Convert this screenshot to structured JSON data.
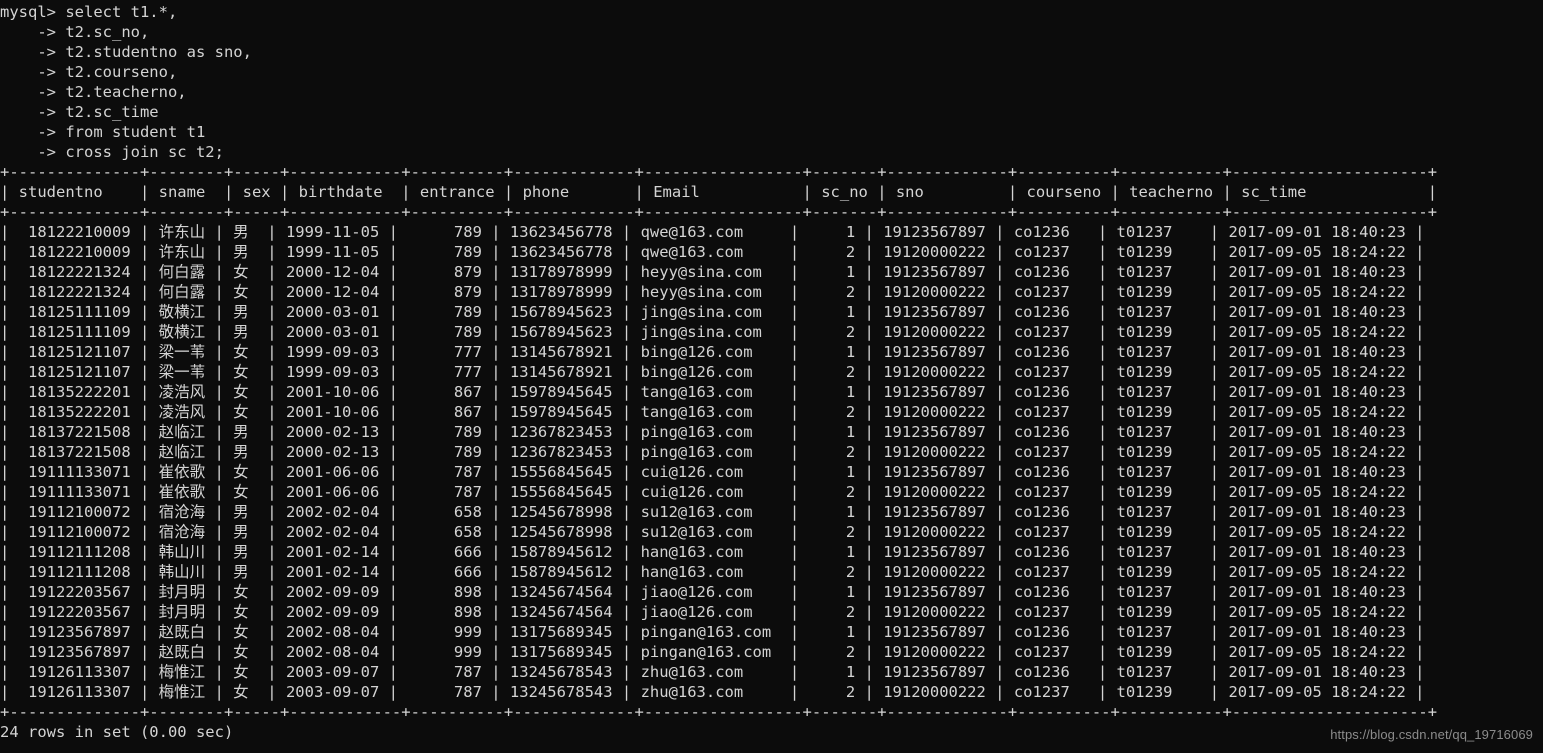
{
  "terminal": {
    "prompt": "mysql>",
    "continuation": "    ->",
    "query_lines": [
      "select t1.*,",
      "t2.sc_no,",
      "t2.studentno as sno,",
      "t2.courseno,",
      "t2.teacherno,",
      "t2.sc_time",
      "from student t1",
      "cross join sc t2;"
    ],
    "result_status": "24 rows in set (0.00 sec)",
    "watermark": "https://blog.csdn.net/qq_19716069",
    "colors": {
      "background": "#0c0c0c",
      "foreground": "#d4d4d4",
      "border": "#c8c2b8",
      "watermark": "#8c8c8c"
    }
  },
  "table": {
    "columns": [
      {
        "key": "studentno",
        "label": "studentno",
        "width": 12,
        "align": "right"
      },
      {
        "key": "sname",
        "label": "sname",
        "width": 6,
        "align": "left"
      },
      {
        "key": "sex",
        "label": "sex",
        "width": 3,
        "align": "left"
      },
      {
        "key": "birthdate",
        "label": "birthdate",
        "width": 10,
        "align": "left"
      },
      {
        "key": "entrance",
        "label": "entrance",
        "width": 8,
        "align": "right"
      },
      {
        "key": "phone",
        "label": "phone",
        "width": 11,
        "align": "left"
      },
      {
        "key": "Email",
        "label": "Email",
        "width": 15,
        "align": "left"
      },
      {
        "key": "sc_no",
        "label": "sc_no",
        "width": 5,
        "align": "right"
      },
      {
        "key": "sno",
        "label": "sno",
        "width": 11,
        "align": "left"
      },
      {
        "key": "courseno",
        "label": "courseno",
        "width": 8,
        "align": "left"
      },
      {
        "key": "teacherno",
        "label": "teacherno",
        "width": 9,
        "align": "left"
      },
      {
        "key": "sc_time",
        "label": "sc_time",
        "width": 19,
        "align": "left"
      }
    ],
    "rows": [
      {
        "studentno": "18122210009",
        "sname": "许东山",
        "sex": "男",
        "birthdate": "1999-11-05",
        "entrance": "789",
        "phone": "13623456778",
        "Email": "qwe@163.com",
        "sc_no": "1",
        "sno": "19123567897",
        "courseno": "co1236",
        "teacherno": "t01237",
        "sc_time": "2017-09-01 18:40:23"
      },
      {
        "studentno": "18122210009",
        "sname": "许东山",
        "sex": "男",
        "birthdate": "1999-11-05",
        "entrance": "789",
        "phone": "13623456778",
        "Email": "qwe@163.com",
        "sc_no": "2",
        "sno": "19120000222",
        "courseno": "co1237",
        "teacherno": "t01239",
        "sc_time": "2017-09-05 18:24:22"
      },
      {
        "studentno": "18122221324",
        "sname": "何白露",
        "sex": "女",
        "birthdate": "2000-12-04",
        "entrance": "879",
        "phone": "13178978999",
        "Email": "heyy@sina.com",
        "sc_no": "1",
        "sno": "19123567897",
        "courseno": "co1236",
        "teacherno": "t01237",
        "sc_time": "2017-09-01 18:40:23"
      },
      {
        "studentno": "18122221324",
        "sname": "何白露",
        "sex": "女",
        "birthdate": "2000-12-04",
        "entrance": "879",
        "phone": "13178978999",
        "Email": "heyy@sina.com",
        "sc_no": "2",
        "sno": "19120000222",
        "courseno": "co1237",
        "teacherno": "t01239",
        "sc_time": "2017-09-05 18:24:22"
      },
      {
        "studentno": "18125111109",
        "sname": "敬横江",
        "sex": "男",
        "birthdate": "2000-03-01",
        "entrance": "789",
        "phone": "15678945623",
        "Email": "jing@sina.com",
        "sc_no": "1",
        "sno": "19123567897",
        "courseno": "co1236",
        "teacherno": "t01237",
        "sc_time": "2017-09-01 18:40:23"
      },
      {
        "studentno": "18125111109",
        "sname": "敬横江",
        "sex": "男",
        "birthdate": "2000-03-01",
        "entrance": "789",
        "phone": "15678945623",
        "Email": "jing@sina.com",
        "sc_no": "2",
        "sno": "19120000222",
        "courseno": "co1237",
        "teacherno": "t01239",
        "sc_time": "2017-09-05 18:24:22"
      },
      {
        "studentno": "18125121107",
        "sname": "梁一苇",
        "sex": "女",
        "birthdate": "1999-09-03",
        "entrance": "777",
        "phone": "13145678921",
        "Email": "bing@126.com",
        "sc_no": "1",
        "sno": "19123567897",
        "courseno": "co1236",
        "teacherno": "t01237",
        "sc_time": "2017-09-01 18:40:23"
      },
      {
        "studentno": "18125121107",
        "sname": "梁一苇",
        "sex": "女",
        "birthdate": "1999-09-03",
        "entrance": "777",
        "phone": "13145678921",
        "Email": "bing@126.com",
        "sc_no": "2",
        "sno": "19120000222",
        "courseno": "co1237",
        "teacherno": "t01239",
        "sc_time": "2017-09-05 18:24:22"
      },
      {
        "studentno": "18135222201",
        "sname": "凌浩风",
        "sex": "女",
        "birthdate": "2001-10-06",
        "entrance": "867",
        "phone": "15978945645",
        "Email": "tang@163.com",
        "sc_no": "1",
        "sno": "19123567897",
        "courseno": "co1236",
        "teacherno": "t01237",
        "sc_time": "2017-09-01 18:40:23"
      },
      {
        "studentno": "18135222201",
        "sname": "凌浩风",
        "sex": "女",
        "birthdate": "2001-10-06",
        "entrance": "867",
        "phone": "15978945645",
        "Email": "tang@163.com",
        "sc_no": "2",
        "sno": "19120000222",
        "courseno": "co1237",
        "teacherno": "t01239",
        "sc_time": "2017-09-05 18:24:22"
      },
      {
        "studentno": "18137221508",
        "sname": "赵临江",
        "sex": "男",
        "birthdate": "2000-02-13",
        "entrance": "789",
        "phone": "12367823453",
        "Email": "ping@163.com",
        "sc_no": "1",
        "sno": "19123567897",
        "courseno": "co1236",
        "teacherno": "t01237",
        "sc_time": "2017-09-01 18:40:23"
      },
      {
        "studentno": "18137221508",
        "sname": "赵临江",
        "sex": "男",
        "birthdate": "2000-02-13",
        "entrance": "789",
        "phone": "12367823453",
        "Email": "ping@163.com",
        "sc_no": "2",
        "sno": "19120000222",
        "courseno": "co1237",
        "teacherno": "t01239",
        "sc_time": "2017-09-05 18:24:22"
      },
      {
        "studentno": "19111133071",
        "sname": "崔依歌",
        "sex": "女",
        "birthdate": "2001-06-06",
        "entrance": "787",
        "phone": "15556845645",
        "Email": "cui@126.com",
        "sc_no": "1",
        "sno": "19123567897",
        "courseno": "co1236",
        "teacherno": "t01237",
        "sc_time": "2017-09-01 18:40:23"
      },
      {
        "studentno": "19111133071",
        "sname": "崔依歌",
        "sex": "女",
        "birthdate": "2001-06-06",
        "entrance": "787",
        "phone": "15556845645",
        "Email": "cui@126.com",
        "sc_no": "2",
        "sno": "19120000222",
        "courseno": "co1237",
        "teacherno": "t01239",
        "sc_time": "2017-09-05 18:24:22"
      },
      {
        "studentno": "19112100072",
        "sname": "宿沧海",
        "sex": "男",
        "birthdate": "2002-02-04",
        "entrance": "658",
        "phone": "12545678998",
        "Email": "su12@163.com",
        "sc_no": "1",
        "sno": "19123567897",
        "courseno": "co1236",
        "teacherno": "t01237",
        "sc_time": "2017-09-01 18:40:23"
      },
      {
        "studentno": "19112100072",
        "sname": "宿沧海",
        "sex": "男",
        "birthdate": "2002-02-04",
        "entrance": "658",
        "phone": "12545678998",
        "Email": "su12@163.com",
        "sc_no": "2",
        "sno": "19120000222",
        "courseno": "co1237",
        "teacherno": "t01239",
        "sc_time": "2017-09-05 18:24:22"
      },
      {
        "studentno": "19112111208",
        "sname": "韩山川",
        "sex": "男",
        "birthdate": "2001-02-14",
        "entrance": "666",
        "phone": "15878945612",
        "Email": "han@163.com",
        "sc_no": "1",
        "sno": "19123567897",
        "courseno": "co1236",
        "teacherno": "t01237",
        "sc_time": "2017-09-01 18:40:23"
      },
      {
        "studentno": "19112111208",
        "sname": "韩山川",
        "sex": "男",
        "birthdate": "2001-02-14",
        "entrance": "666",
        "phone": "15878945612",
        "Email": "han@163.com",
        "sc_no": "2",
        "sno": "19120000222",
        "courseno": "co1237",
        "teacherno": "t01239",
        "sc_time": "2017-09-05 18:24:22"
      },
      {
        "studentno": "19122203567",
        "sname": "封月明",
        "sex": "女",
        "birthdate": "2002-09-09",
        "entrance": "898",
        "phone": "13245674564",
        "Email": "jiao@126.com",
        "sc_no": "1",
        "sno": "19123567897",
        "courseno": "co1236",
        "teacherno": "t01237",
        "sc_time": "2017-09-01 18:40:23"
      },
      {
        "studentno": "19122203567",
        "sname": "封月明",
        "sex": "女",
        "birthdate": "2002-09-09",
        "entrance": "898",
        "phone": "13245674564",
        "Email": "jiao@126.com",
        "sc_no": "2",
        "sno": "19120000222",
        "courseno": "co1237",
        "teacherno": "t01239",
        "sc_time": "2017-09-05 18:24:22"
      },
      {
        "studentno": "19123567897",
        "sname": "赵既白",
        "sex": "女",
        "birthdate": "2002-08-04",
        "entrance": "999",
        "phone": "13175689345",
        "Email": "pingan@163.com",
        "sc_no": "1",
        "sno": "19123567897",
        "courseno": "co1236",
        "teacherno": "t01237",
        "sc_time": "2017-09-01 18:40:23"
      },
      {
        "studentno": "19123567897",
        "sname": "赵既白",
        "sex": "女",
        "birthdate": "2002-08-04",
        "entrance": "999",
        "phone": "13175689345",
        "Email": "pingan@163.com",
        "sc_no": "2",
        "sno": "19120000222",
        "courseno": "co1237",
        "teacherno": "t01239",
        "sc_time": "2017-09-05 18:24:22"
      },
      {
        "studentno": "19126113307",
        "sname": "梅惟江",
        "sex": "女",
        "birthdate": "2003-09-07",
        "entrance": "787",
        "phone": "13245678543",
        "Email": "zhu@163.com",
        "sc_no": "1",
        "sno": "19123567897",
        "courseno": "co1236",
        "teacherno": "t01237",
        "sc_time": "2017-09-01 18:40:23"
      },
      {
        "studentno": "19126113307",
        "sname": "梅惟江",
        "sex": "女",
        "birthdate": "2003-09-07",
        "entrance": "787",
        "phone": "13245678543",
        "Email": "zhu@163.com",
        "sc_no": "2",
        "sno": "19120000222",
        "courseno": "co1237",
        "teacherno": "t01239",
        "sc_time": "2017-09-05 18:24:22"
      }
    ]
  }
}
